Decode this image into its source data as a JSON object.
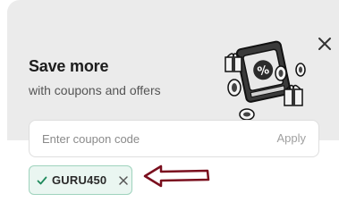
{
  "modal": {
    "title": "Save more",
    "subtitle": "with coupons and offers"
  },
  "coupon_input": {
    "placeholder": "Enter coupon code",
    "value": "",
    "apply_label": "Apply"
  },
  "applied_coupon": {
    "code": "GURU450"
  },
  "icons": {
    "close": "close-icon",
    "check": "check-icon",
    "remove": "remove-coupon-icon",
    "illustration": "coupon-gift-illustration",
    "annotation": "red-arrow-annotation"
  },
  "colors": {
    "header_bg": "#ebebeb",
    "chip_bg": "#eaf6f1",
    "chip_border": "#9fd3bd",
    "check_green": "#1f8a5c",
    "arrow_red": "#7a0f1e"
  }
}
